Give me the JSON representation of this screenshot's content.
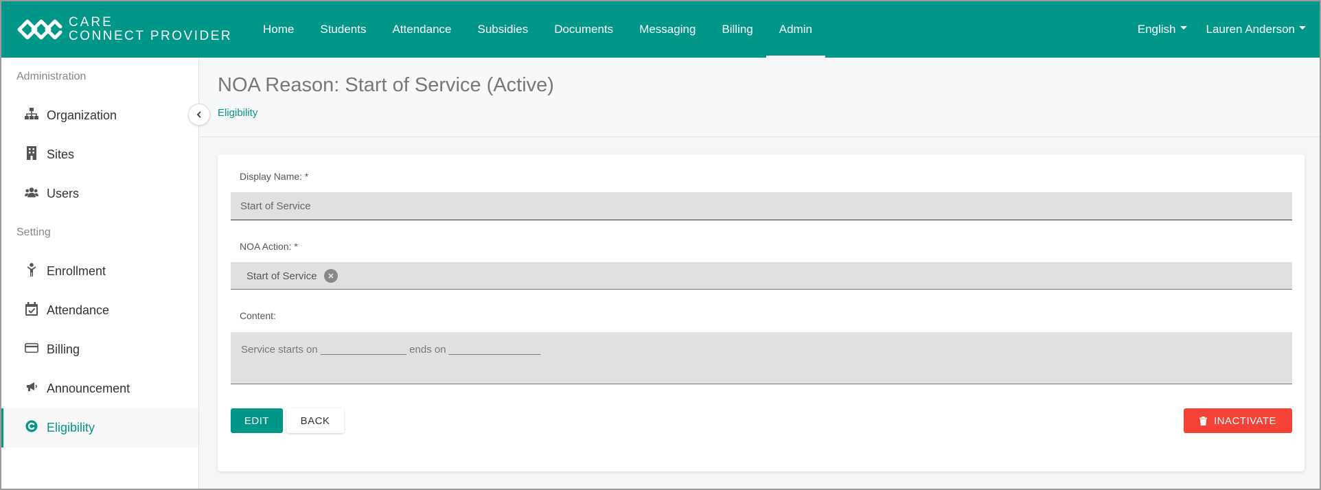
{
  "brand": {
    "line1": "CARE",
    "line2": "CONNECT PROVIDER"
  },
  "nav": {
    "items": [
      "Home",
      "Students",
      "Attendance",
      "Subsidies",
      "Documents",
      "Messaging",
      "Billing",
      "Admin"
    ],
    "active": "Admin",
    "language": "English",
    "user": "Lauren Anderson"
  },
  "sidebar": {
    "section_admin": "Administration",
    "admin_items": [
      {
        "label": "Organization",
        "icon": "sitemap-icon"
      },
      {
        "label": "Sites",
        "icon": "building-icon"
      },
      {
        "label": "Users",
        "icon": "users-icon"
      }
    ],
    "section_setting": "Setting",
    "setting_items": [
      {
        "label": "Enrollment",
        "icon": "child-icon"
      },
      {
        "label": "Attendance",
        "icon": "calendar-check-icon"
      },
      {
        "label": "Billing",
        "icon": "credit-card-icon"
      },
      {
        "label": "Announcement",
        "icon": "bullhorn-icon"
      },
      {
        "label": "Eligibility",
        "icon": "eligibility-icon"
      }
    ],
    "active": "Eligibility"
  },
  "page": {
    "title": "NOA Reason: Start of Service (Active)",
    "breadcrumb": "Eligibility"
  },
  "form": {
    "display_name_label": "Display Name: *",
    "display_name_value": "Start of Service",
    "noa_action_label": "NOA Action: *",
    "noa_action_chip": "Start of Service",
    "content_label": "Content:",
    "content_value": "Service starts on _______________ ends on ________________"
  },
  "buttons": {
    "edit": "EDIT",
    "back": "BACK",
    "inactivate": "INACTIVATE"
  },
  "colors": {
    "primary": "#009688",
    "danger": "#f44336"
  }
}
